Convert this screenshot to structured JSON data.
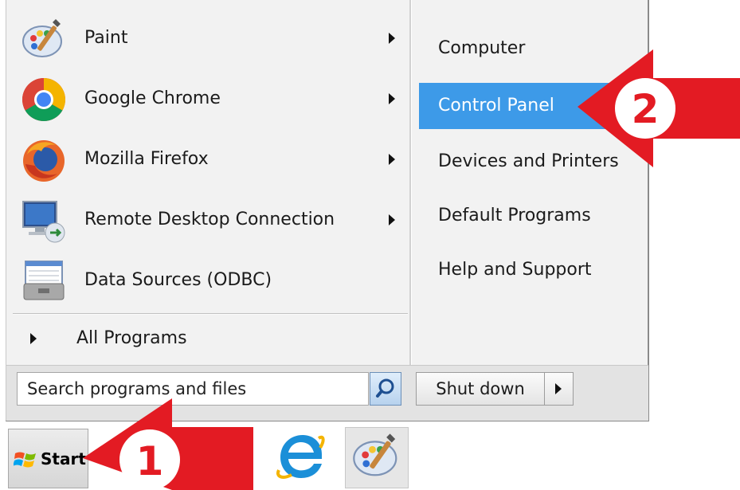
{
  "start_menu": {
    "programs": [
      {
        "label": "Paint",
        "icon": "paint-icon",
        "has_submenu": true
      },
      {
        "label": "Google Chrome",
        "icon": "chrome-icon",
        "has_submenu": true
      },
      {
        "label": "Mozilla Firefox",
        "icon": "firefox-icon",
        "has_submenu": true
      },
      {
        "label": "Remote Desktop Connection",
        "icon": "remote-desktop-icon",
        "has_submenu": true
      },
      {
        "label": "Data Sources (ODBC)",
        "icon": "odbc-icon",
        "has_submenu": false
      }
    ],
    "all_programs_label": "All Programs",
    "right_items": [
      {
        "label": "Computer"
      },
      {
        "label": "Control Panel"
      },
      {
        "label": "Devices and Printers"
      },
      {
        "label": "Default Programs"
      },
      {
        "label": "Help and Support"
      }
    ],
    "highlighted_item": "Control Panel",
    "search": {
      "placeholder": "Search programs and files"
    },
    "shutdown_label": "Shut down"
  },
  "taskbar": {
    "start_label": "Start",
    "pinned": [
      "internet-explorer-icon",
      "paint-icon"
    ]
  },
  "annotations": {
    "step1": "1",
    "step2": "2",
    "color": "#e31b23"
  },
  "colors": {
    "highlight": "#3d9ae8",
    "menu_bg": "#f2f2f2"
  }
}
